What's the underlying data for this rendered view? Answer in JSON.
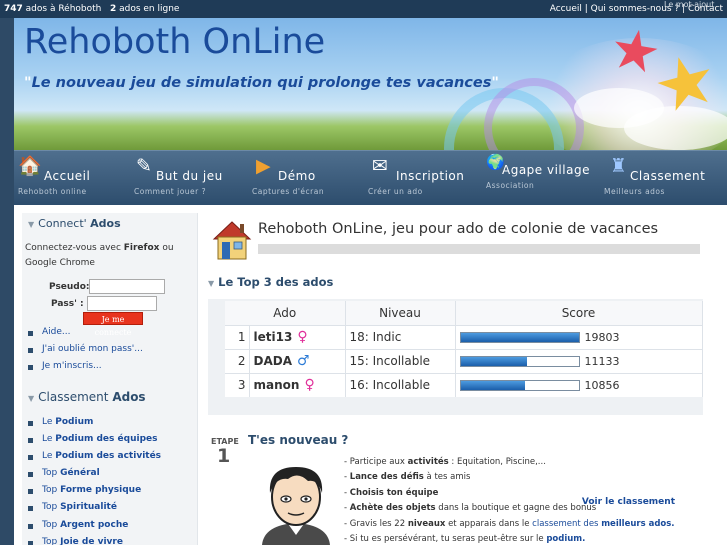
{
  "topbar": {
    "stats_count": "747",
    "stats_text": " ados à Réhoboth",
    "online_count": "2",
    "online_text": " ados en ligne",
    "links": "Accueil | Qui sommes-nous ? | Contact",
    "ghost": "Le mot ajout"
  },
  "banner": {
    "title": "Rehoboth OnLine",
    "slogan_open": "\"",
    "slogan": "Le nouveau jeu de simulation qui prolonge tes vacances",
    "slogan_close": "\""
  },
  "nav": [
    {
      "icon": "house-icon",
      "glyph": "🏠",
      "label": "Accueil",
      "sub": "Rehoboth online"
    },
    {
      "icon": "pencil-icon",
      "glyph": "✎",
      "label": "But du jeu",
      "sub": "Comment jouer ?"
    },
    {
      "icon": "demo-icon",
      "glyph": "▶",
      "label": "Démo",
      "sub": "Captures d'écran"
    },
    {
      "icon": "register-icon",
      "glyph": "✉",
      "label": "Inscription",
      "sub": "Créer un ado"
    },
    {
      "icon": "globe-icon",
      "glyph": "🌍",
      "label": "Agape village",
      "sub": "Association"
    },
    {
      "icon": "ranking-icon",
      "glyph": "♜",
      "label": "Classement",
      "sub": "Meilleurs ados"
    }
  ],
  "sidebar": {
    "connect_h1": "Connect' ",
    "connect_h2": "Ados",
    "connect_intro_1": "Connectez-vous avec ",
    "connect_intro_b": "Firefox",
    "connect_intro_2": " ou",
    "connect_intro_3": "Google Chrome",
    "pseudo_label": "Pseudo:",
    "pass_label": "Pass' :",
    "connect_button": "Je me connecte",
    "help_links": [
      "Aide...",
      "J'ai oublié mon pass'...",
      "Je m'inscris..."
    ],
    "classement_h1": "Classement ",
    "classement_h2": "Ados",
    "classement_links": [
      {
        "pre": "Le ",
        "bold": "Podium"
      },
      {
        "pre": "Le ",
        "bold": "Podium des équipes"
      },
      {
        "pre": "Le ",
        "bold": "Podium des activités"
      },
      {
        "pre": "Top ",
        "bold": "Général"
      },
      {
        "pre": "Top ",
        "bold": "Forme physique"
      },
      {
        "pre": "Top ",
        "bold": "Spiritualité"
      },
      {
        "pre": "Top ",
        "bold": "Argent poche"
      },
      {
        "pre": "Top ",
        "bold": "Joie de vivre"
      }
    ]
  },
  "main": {
    "title": "Rehoboth OnLine, jeu pour ado de colonie de vacances",
    "top3_title": "Le Top 3 des ados",
    "columns": [
      "Ado",
      "Niveau",
      "Score"
    ],
    "rows": [
      {
        "rank": "1",
        "name": "leti13",
        "sex": "♀",
        "sex_color": "#e0309a",
        "level": "18: Indic",
        "score": "19803",
        "score_fraction": 1.0
      },
      {
        "rank": "2",
        "name": "DADA",
        "sex": "♂",
        "sex_color": "#2c7bd6",
        "level": "15: Incollable",
        "score": "11133",
        "score_fraction": 0.562
      },
      {
        "rank": "3",
        "name": "manon",
        "sex": "♀",
        "sex_color": "#e0309a",
        "level": "16: Incollable",
        "score": "10856",
        "score_fraction": 0.548
      }
    ],
    "see_all": "Voir le classement",
    "step_label": "ETAPE",
    "step_number": "1",
    "step_title": "T'es nouveau ?",
    "steps": [
      {
        "pre": "- Participe aux ",
        "b": "activités",
        "post": " : Equitation, Piscine,..."
      },
      {
        "pre": "- ",
        "b": "Lance des défis",
        "post": " à tes amis"
      },
      {
        "pre": "- ",
        "b": "Choisis ton équipe",
        "post": ""
      },
      {
        "pre": "- ",
        "b": "Achète des objets",
        "post": " dans la boutique et gagne des bonus"
      },
      {
        "pre": "- Gravis les 22 ",
        "b": "niveaux",
        "post": " et apparais dans le ",
        "lk": "classement des ",
        "b2": "meilleurs ados."
      },
      {
        "pre": "- Si tu es persévérant, tu seras peut-être sur le ",
        "b": "podium.",
        "post": ""
      }
    ]
  }
}
